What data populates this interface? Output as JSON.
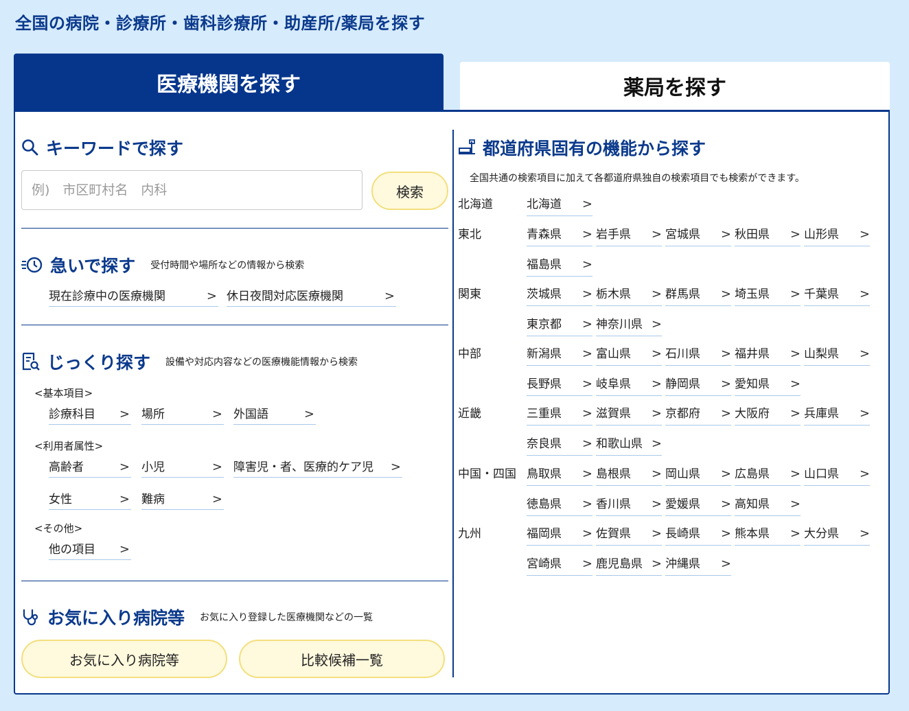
{
  "page_title": "全国の病院・診療所・歯科診療所・助産所/薬局を探す",
  "tabs": {
    "medical": "医療機関を探す",
    "pharmacy": "薬局を探す"
  },
  "keyword": {
    "title": "キーワードで探す",
    "placeholder": "例)　市区町村名　内科",
    "button": "検索"
  },
  "urgent": {
    "title": "急いで探す",
    "subtitle": "受付時間や場所などの情報から検索",
    "links": [
      "現在診療中の医療機関",
      "休日夜間対応医療機関"
    ]
  },
  "detailed": {
    "title": "じっくり探す",
    "subtitle": "設備や対応内容などの医療機能情報から検索",
    "groups": [
      {
        "label": "<基本項目>",
        "items": [
          "診療科目",
          "場所",
          "外国語"
        ]
      },
      {
        "label": "<利用者属性>",
        "items": [
          "高齢者",
          "小児",
          "障害児・者、医療的ケア児",
          "女性",
          "難病"
        ]
      },
      {
        "label": "<その他>",
        "items": [
          "他の項目"
        ]
      }
    ]
  },
  "favorites": {
    "title": "お気に入り病院等",
    "subtitle": "お気に入り登録した医療機関などの一覧",
    "buttons": [
      "お気に入り病院等",
      "比較候補一覧"
    ]
  },
  "prefecture": {
    "title": "都道府県固有の機能から探す",
    "description": "全国共通の検索項目に加えて各都道府県独自の検索項目でも検索ができます。",
    "regions": [
      {
        "name": "北海道",
        "prefs": [
          "北海道"
        ]
      },
      {
        "name": "東北",
        "prefs": [
          "青森県",
          "岩手県",
          "宮城県",
          "秋田県",
          "山形県",
          "福島県"
        ]
      },
      {
        "name": "関東",
        "prefs": [
          "茨城県",
          "栃木県",
          "群馬県",
          "埼玉県",
          "千葉県",
          "東京都",
          "神奈川県"
        ]
      },
      {
        "name": "中部",
        "prefs": [
          "新潟県",
          "富山県",
          "石川県",
          "福井県",
          "山梨県",
          "長野県",
          "岐阜県",
          "静岡県",
          "愛知県"
        ]
      },
      {
        "name": "近畿",
        "prefs": [
          "三重県",
          "滋賀県",
          "京都府",
          "大阪府",
          "兵庫県",
          "奈良県",
          "和歌山県"
        ]
      },
      {
        "name": "中国・四国",
        "prefs": [
          "鳥取県",
          "島根県",
          "岡山県",
          "広島県",
          "山口県",
          "徳島県",
          "香川県",
          "愛媛県",
          "高知県"
        ]
      },
      {
        "name": "九州",
        "prefs": [
          "福岡県",
          "佐賀県",
          "長崎県",
          "熊本県",
          "大分県",
          "宮崎県",
          "鹿児島県",
          "沖縄県"
        ]
      }
    ]
  },
  "chevron": ">",
  "colors": {
    "primary": "#06368c",
    "accent_button": "#fff9dd",
    "background": "#d6ebfc"
  }
}
